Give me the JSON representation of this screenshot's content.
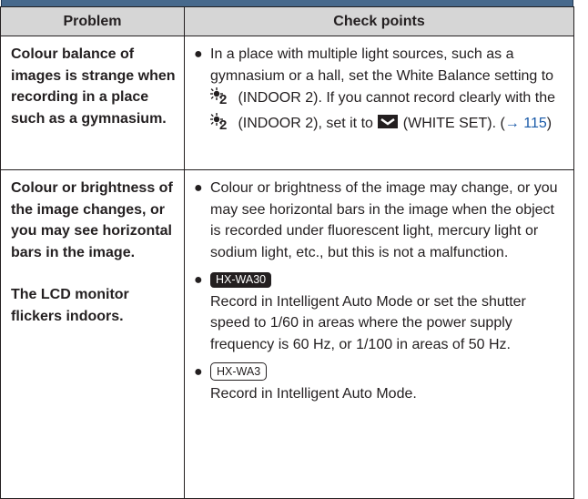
{
  "table": {
    "headers": [
      "Problem",
      "Check points"
    ],
    "rows": [
      {
        "problem": [
          "Colour balance of images is strange when recording in a place such as a gymnasium."
        ],
        "points": [
          {
            "t1": "In a place with multiple light sources, such as a gymnasium or a hall, set the White Balance setting to ",
            "t2": " (INDOOR 2). If you cannot record clearly with the ",
            "t3": " (INDOOR 2), set it to ",
            "t4": " (WHITE SET). (",
            "link_arrow": "→ 115",
            "t5": ")"
          }
        ]
      },
      {
        "problem": [
          "Colour or brightness of the image changes, or you may see horizontal bars in the image.",
          "The LCD monitor flickers indoors."
        ],
        "points": [
          {
            "text": "Colour or brightness of the image may change, or you may see horizontal bars in the image when the object is recorded under fluorescent light, mercury light or sodium light, etc., but this is not a malfunction."
          },
          {
            "model": "HX-WA30",
            "text": "Record in Intelligent Auto Mode or set the shutter speed to 1/60 in areas where the power supply frequency is 60 Hz, or 1/100 in areas of 50 Hz."
          },
          {
            "model": "HX-WA3",
            "text": "Record in Intelligent Auto Mode."
          }
        ]
      }
    ]
  },
  "icons": {
    "indoor2": "indoor-2-white-balance-icon",
    "whiteset": "white-set-icon"
  },
  "colors": {
    "header_bg": "#d6d6d6",
    "banner": "#47698c",
    "link": "#1a5aa8",
    "text": "#231f20"
  }
}
